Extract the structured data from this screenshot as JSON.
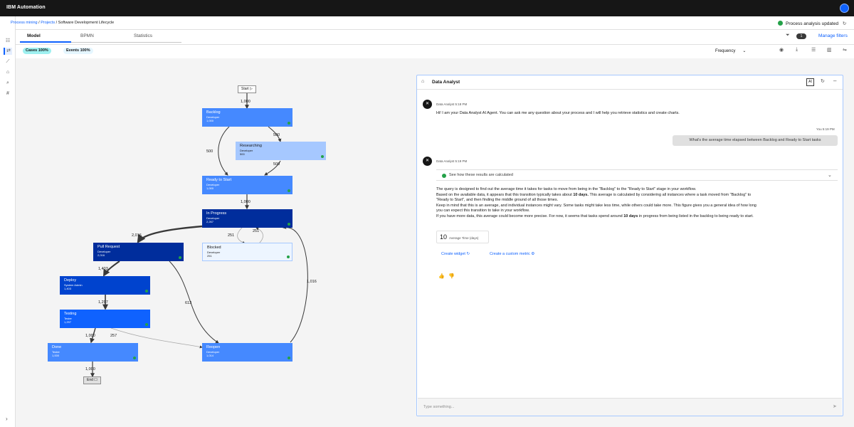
{
  "app": {
    "brand": "IBM Automation"
  },
  "breadcrumb": {
    "item1": "Process mining",
    "item2": "Projects",
    "sep": "/",
    "current": "Software Development Lifecycle"
  },
  "status": {
    "text": "Process analysis updated",
    "color": "#24a148"
  },
  "tabs": [
    {
      "label": "Model"
    },
    {
      "label": "BPMN"
    },
    {
      "label": "Statistics"
    }
  ],
  "filters": {
    "count": "1",
    "manage_label": "Manage filters"
  },
  "pills": {
    "cases": "Cases 100%",
    "events": "Events 100%"
  },
  "view": {
    "mode": "Frequency"
  },
  "accent": "#0f62fe",
  "flow": {
    "start": "Start",
    "end": "End",
    "nodes": [
      {
        "title": "Backlog",
        "role": "Developer",
        "count": "1,000"
      },
      {
        "title": "Researching",
        "role": "Developer",
        "count": "500"
      },
      {
        "title": "Ready to Start",
        "role": "Developer",
        "count": "1,000"
      },
      {
        "title": "In Progress",
        "role": "Developer",
        "count": "2,267"
      },
      {
        "title": "Pull Request",
        "role": "Developer",
        "count": "2,016"
      },
      {
        "title": "Blocked",
        "role": "Developer",
        "count": "251"
      },
      {
        "title": "Deploy",
        "role": "System Admin",
        "count": "1,403"
      },
      {
        "title": "Testing",
        "role": "Tester",
        "count": "1,297"
      },
      {
        "title": "Done",
        "role": "Tester",
        "count": "1,000"
      },
      {
        "title": "Reopen",
        "role": "Developer",
        "count": "1,014"
      }
    ],
    "edges": [
      "1,000",
      "500",
      "500",
      "500",
      "1,000",
      "2,016",
      "251",
      "251",
      "1,403",
      "613",
      "1,016",
      "1,297",
      "1,000",
      "257",
      "1,000"
    ]
  },
  "panel": {
    "title": "Data Analyst",
    "ai_badge": "AI",
    "msg1_meta": "Data Analyst 5:18 PM",
    "msg1_text": "Hi! I am your Data Analyst AI Agent. You can ask me any question about your process and I will help you retrieve statistics and create charts.",
    "user_meta": "You 5:19 PM",
    "user_text": "What's the average time elapsed between Backlog and Ready to Start tasks",
    "msg2_meta": "Data Analyst 5:19 PM",
    "how_label": "See how these results are calculated",
    "answer": {
      "l1": "The query is designed to find out the average time it takes for tasks to move from being in the \"Backlog\" to the \"Ready to Start\" stage in your workflow.",
      "l2a": "Based on the available data, it appears that this transition typically takes about ",
      "l2b": "10 days.",
      "l2c": " This average is calculated by considering all instances where a task moved from \"Backlog\" to",
      "l3": "\"Ready to Start\", and then finding the middle ground of all those times.",
      "l4": "Keep in mind that this is an average, and individual instances might vary. Some tasks might take less time, while others could take more. This figure gives you a general idea of how long",
      "l5": "you can expect this transition to take in your workflow.",
      "l6a": "If you have more data, this average could become more precise. For now, it seems that tasks spend around ",
      "l6b": "10 days",
      "l6c": " in progress from being listed in the backlog to being ready to start."
    },
    "kpi_value": "10",
    "kpi_label": "Average Time (days)",
    "link1": "Create widget",
    "link2": "Create a custom metric",
    "input_placeholder": "Type something..."
  }
}
